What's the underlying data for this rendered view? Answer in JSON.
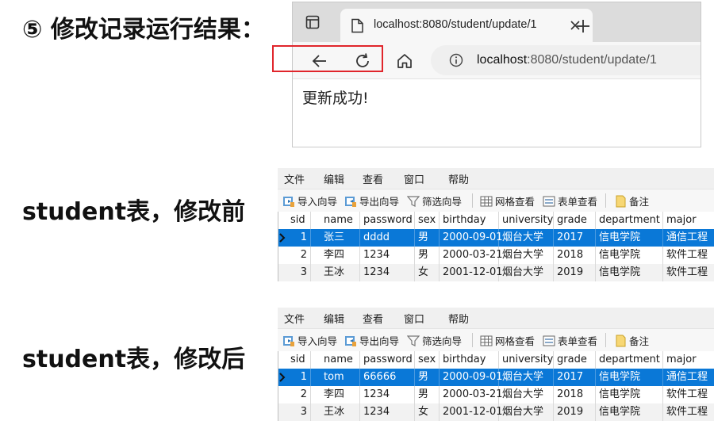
{
  "captions": {
    "result": "⑤ 修改记录运行结果：",
    "before": "student表，修改前",
    "after": "student表，修改后"
  },
  "browser": {
    "tab_title": "localhost:8080/student/update/1",
    "url_host": "localhost",
    "url_port": ":8080",
    "url_path": "/student/update/1",
    "page_message": "更新成功!"
  },
  "navicat": {
    "menu": [
      "文件",
      "编辑",
      "查看",
      "窗口",
      "帮助"
    ],
    "tools": [
      "导入向导",
      "导出向导",
      "筛选向导",
      "网格查看",
      "表单查看",
      "备注"
    ],
    "columns": [
      "sid",
      "name",
      "password",
      "sex",
      "birthday",
      "university",
      "grade",
      "department",
      "major"
    ]
  },
  "table_before": [
    [
      "1",
      "张三",
      "dddd",
      "男",
      "2000-09-01",
      "烟台大学",
      "2017",
      "信电学院",
      "通信工程"
    ],
    [
      "2",
      "李四",
      "1234",
      "男",
      "2000-03-21",
      "烟台大学",
      "2018",
      "信电学院",
      "软件工程"
    ],
    [
      "3",
      "王冰",
      "1234",
      "女",
      "2001-12-01",
      "烟台大学",
      "2019",
      "信电学院",
      "软件工程"
    ]
  ],
  "table_after": [
    [
      "1",
      "tom",
      "66666",
      "男",
      "2000-09-01",
      "烟台大学",
      "2017",
      "信电学院",
      "通信工程"
    ],
    [
      "2",
      "李四",
      "1234",
      "男",
      "2000-03-21",
      "烟台大学",
      "2018",
      "信电学院",
      "软件工程"
    ],
    [
      "3",
      "王冰",
      "1234",
      "女",
      "2001-12-01",
      "烟台大学",
      "2019",
      "信电学院",
      "软件工程"
    ]
  ],
  "colors": {
    "selected_row": "#0a78d7",
    "url_highlight": "#e0252b"
  }
}
